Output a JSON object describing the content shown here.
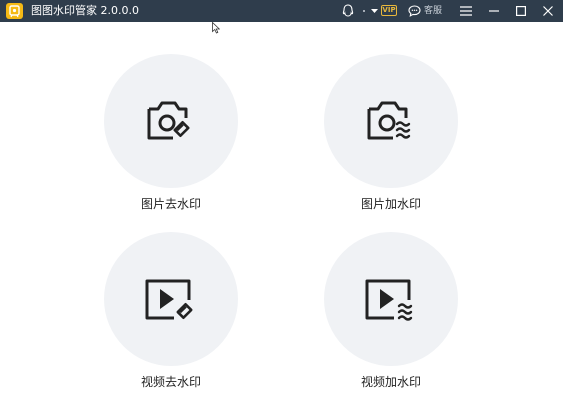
{
  "window": {
    "title": "图图水印管家  2.0.0.0",
    "vip_badge": "VIP",
    "service_label": "客服",
    "colors": {
      "titlebar": "#2f3d4c",
      "logo": "#f5b915",
      "vip": "#e8b83c",
      "circle": "#f0f2f5"
    },
    "icons": [
      "app-logo-icon",
      "qq-icon",
      "dropdown-arrow-icon",
      "chat-bubble-icon",
      "menu-icon",
      "minimize-icon",
      "maximize-icon",
      "close-icon"
    ]
  },
  "features": [
    {
      "label": "图片去水印",
      "icon": "camera-eraser-icon"
    },
    {
      "label": "图片加水印",
      "icon": "camera-wave-icon"
    },
    {
      "label": "视频去水印",
      "icon": "video-eraser-icon"
    },
    {
      "label": "视频加水印",
      "icon": "video-wave-icon"
    }
  ]
}
